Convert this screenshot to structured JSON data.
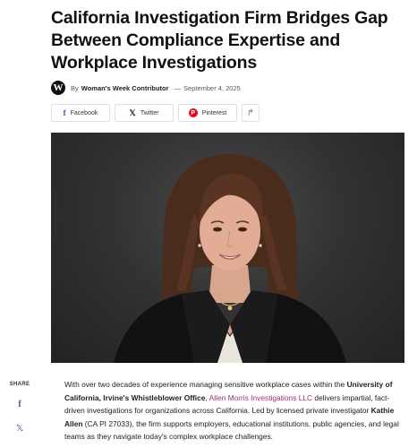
{
  "article": {
    "title": "California Investigation Firm Bridges Gap Between Compliance Expertise and Workplace Investigations",
    "byline": {
      "logo_letter": "W",
      "by": "By",
      "author": "Woman's Week Contributor",
      "separator": "—",
      "date": "September 4, 2025"
    },
    "share_buttons": [
      {
        "label": "Facebook",
        "icon": "facebook-icon",
        "glyph": "f"
      },
      {
        "label": "Twitter",
        "icon": "x-icon",
        "glyph": "𝕏"
      },
      {
        "label": "Pinterest",
        "icon": "pinterest-icon",
        "glyph": "P"
      },
      {
        "label": "",
        "icon": "share-arrow-icon",
        "glyph": "↱"
      }
    ],
    "hero_image": {
      "alt": "Portrait of Kathie Allen"
    },
    "sidebar_share": {
      "label": "SHARE",
      "icons": [
        {
          "icon": "facebook-icon",
          "glyph": "f"
        },
        {
          "icon": "x-icon",
          "glyph": "𝕏"
        }
      ]
    },
    "body": {
      "p1_a": "With over two decades of experience managing sensitive workplace cases within the ",
      "p1_b": "University of California, Irvine's Whistleblower Office",
      "p1_c": ", ",
      "p1_link": "Allen Morris Investigations LLC",
      "p1_d": " delivers impartial, fact-driven investigations for organizations across California. Led by licensed private investigator ",
      "p1_e": "Kathie Allen",
      "p1_f": " (CA PI 27033), the firm supports employers, educational institutions, public agencies, and legal teams as they navigate today's complex workplace challenges."
    }
  },
  "colors": {
    "link": "#a0306e",
    "facebook": "#3b5998",
    "pinterest": "#e60023"
  }
}
